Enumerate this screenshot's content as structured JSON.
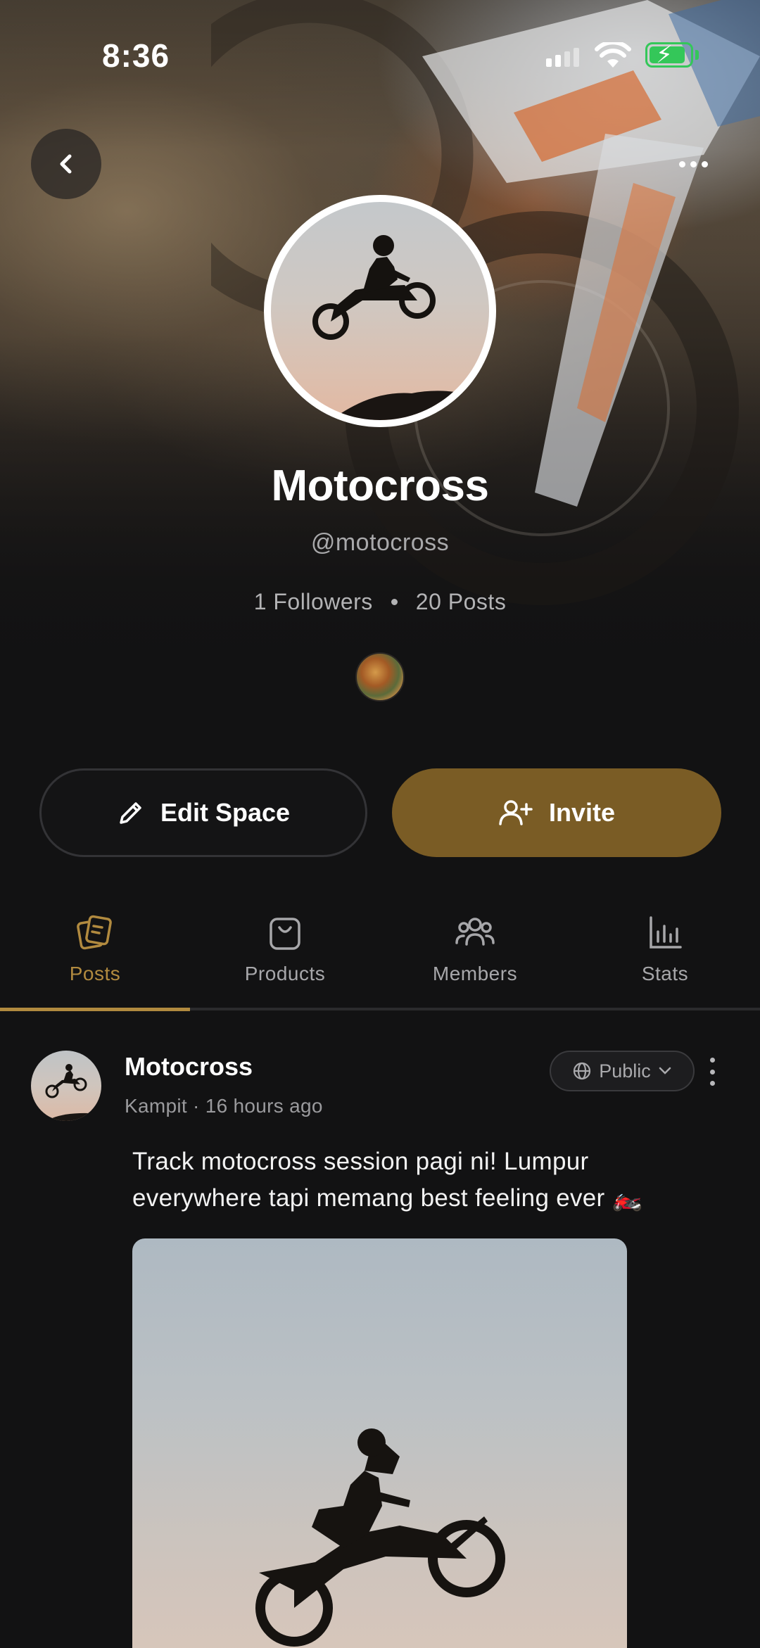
{
  "status_bar": {
    "time": "8:36"
  },
  "profile": {
    "name": "Motocross",
    "handle": "@motocross",
    "followers": "1 Followers",
    "posts": "20 Posts"
  },
  "actions": {
    "edit_label": "Edit Space",
    "invite_label": "Invite"
  },
  "tabs": [
    {
      "label": "Posts",
      "icon": "posts-icon",
      "active": true
    },
    {
      "label": "Products",
      "icon": "bag-icon",
      "active": false
    },
    {
      "label": "Members",
      "icon": "members-icon",
      "active": false
    },
    {
      "label": "Stats",
      "icon": "bar-chart-icon",
      "active": false
    }
  ],
  "post": {
    "author": "Motocross",
    "meta": "Kampit · 16 hours ago",
    "visibility": "Public",
    "text": "Track motocross session pagi ni! Lumpur everywhere tapi memang best feeling ever 🏍️"
  },
  "colors": {
    "accent": "#b18a3f",
    "invite_bg": "#7a5c25",
    "background": "#121213",
    "battery": "#34c759"
  }
}
